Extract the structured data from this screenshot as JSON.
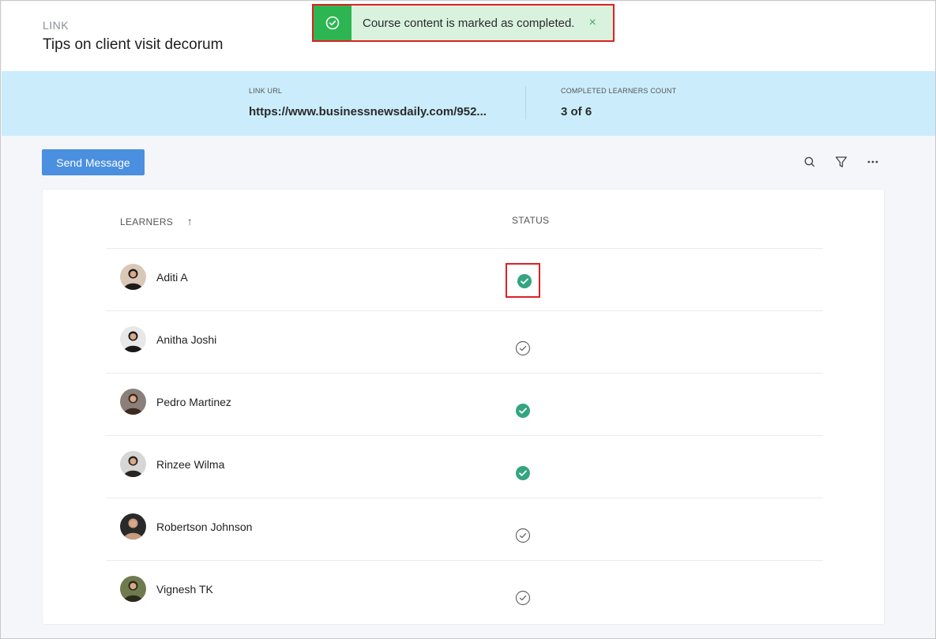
{
  "header": {
    "kind": "LINK",
    "title": "Tips on client visit decorum"
  },
  "toast": {
    "message": "Course content is marked as completed.",
    "close_symbol": "×"
  },
  "banner": {
    "link_url_label": "LINK URL",
    "link_url_value": "https://www.businessnewsdaily.com/952...",
    "completed_label": "COMPLETED LEARNERS COUNT",
    "completed_value": "3 of 6"
  },
  "toolbar": {
    "send_message_label": "Send Message",
    "icons": [
      "search-icon",
      "filter-icon",
      "more-icon"
    ]
  },
  "table": {
    "headers": {
      "learners": "LEARNERS",
      "learners_sort_arrow": "↑",
      "status": "STATUS"
    },
    "rows": [
      {
        "name": "Aditi A",
        "status": "completed"
      },
      {
        "name": "Anitha Joshi",
        "status": "pending"
      },
      {
        "name": "Pedro Martinez",
        "status": "completed"
      },
      {
        "name": "Rinzee Wilma",
        "status": "completed"
      },
      {
        "name": "Robertson Johnson",
        "status": "pending"
      },
      {
        "name": "Vignesh TK",
        "status": "pending"
      }
    ]
  },
  "colors": {
    "accent": "#4a8fe0",
    "completed": "#34a57e",
    "banner": "#cbedfb",
    "toast": "#2db552",
    "highlight": "#e02020"
  }
}
